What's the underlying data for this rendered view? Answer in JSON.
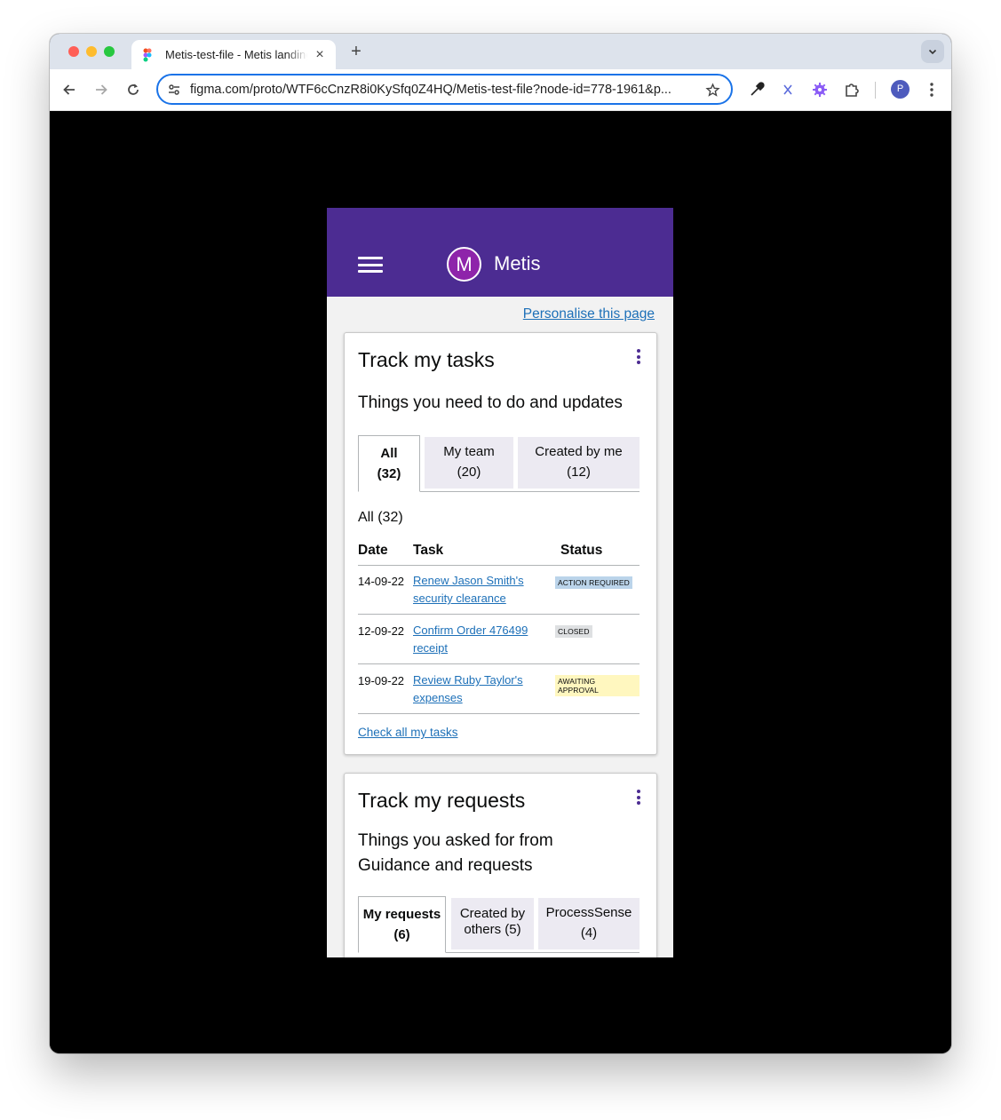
{
  "browser": {
    "tab_title": "Metis-test-file - Metis landing",
    "tab_close": "×",
    "new_tab": "+",
    "url": "figma.com/proto/WTF6cCnzR8i0KySfq0Z4HQ/Metis-test-file?node-id=778-1961&p...",
    "profile_initial": "P",
    "icons": [
      "back-icon",
      "forward-icon",
      "reload-icon",
      "site-settings-icon",
      "star-icon",
      "eyedropper-icon",
      "extension-x-icon",
      "extension-gear-icon",
      "extensions-puzzle-icon",
      "more-vert-icon"
    ]
  },
  "app": {
    "logo_letter": "M",
    "name": "Metis",
    "personalise_link": "Personalise this page",
    "brand_color": "#4c2c92",
    "link_color": "#1d70b8"
  },
  "tasks_card": {
    "title": "Track my tasks",
    "subtitle": "Things you need to do and updates",
    "tabs": [
      {
        "line1": "All",
        "line2": "(32)",
        "active": true
      },
      {
        "line1": "My team",
        "line2": "(20)",
        "active": false
      },
      {
        "line1": "Created by me",
        "line2": "(12)",
        "active": false
      }
    ],
    "section_heading": "All (32)",
    "columns": [
      "Date",
      "Task",
      "Status"
    ],
    "rows": [
      {
        "date": "14-09-22",
        "task_line1": "Renew Jason Smith's",
        "task_line2": "security clearance",
        "status": "ACTION REQUIRED",
        "status_color": "#bbd4ea"
      },
      {
        "date": "12-09-22",
        "task_line1": "Confirm Order 476499",
        "task_line2": "receipt",
        "status": "CLOSED",
        "status_color": "#dee0e2"
      },
      {
        "date": "19-09-22",
        "task_line1": "Review Ruby Taylor's",
        "task_line2": "expenses",
        "status": "AWAITING APPROVAL",
        "status_color": "#fff7bf"
      }
    ],
    "footer_link": "Check all my tasks"
  },
  "requests_card": {
    "title": "Track my requests",
    "subtitle_line1": "Things you asked for from",
    "subtitle_line2": "Guidance and requests",
    "tabs": [
      {
        "line1": "My requests",
        "line2": "(6)",
        "active": true
      },
      {
        "line1": "Created by",
        "line2": "others (5)",
        "active": false
      },
      {
        "line1": "ProcessSense",
        "line2": "(4)",
        "active": false
      }
    ]
  }
}
